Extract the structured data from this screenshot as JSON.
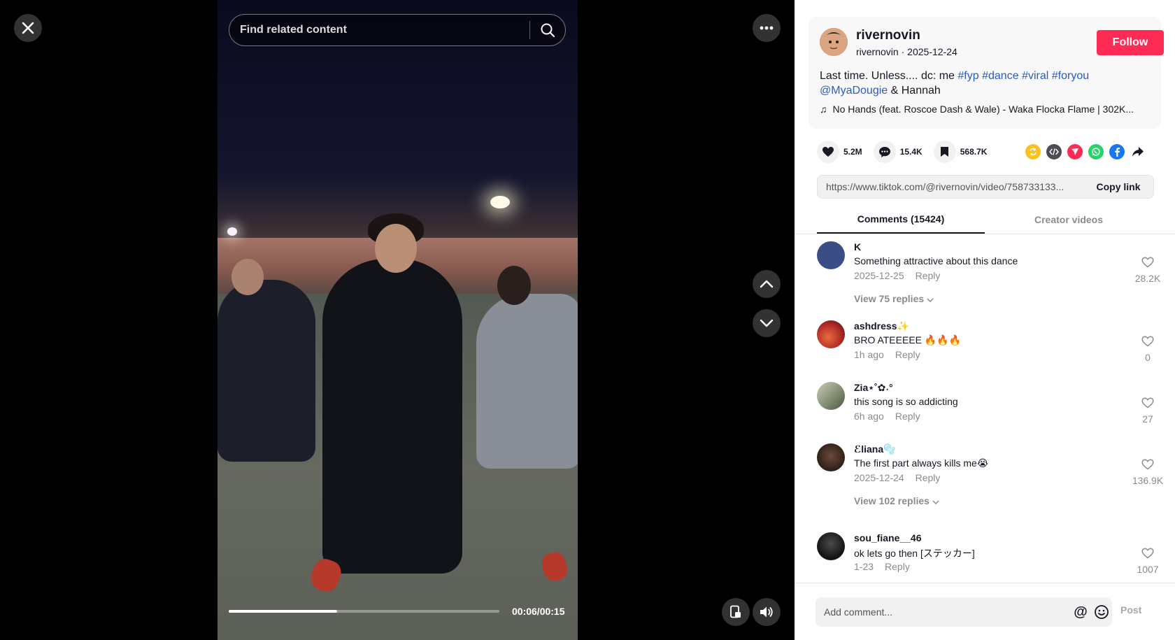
{
  "search": {
    "placeholder": "Find related content"
  },
  "video": {
    "time": "00:06/00:15",
    "progress": 0.4
  },
  "post": {
    "username": "rivernovin",
    "handle": "rivernovin",
    "date": "2025-12-24",
    "follow_label": "Follow",
    "desc_text": "Last time. Unless.... dc: me",
    "tags": [
      "#fyp",
      "#dance",
      "#viral",
      "#foryou"
    ],
    "mention": "@MyaDougie",
    "desc_tail": "& Hannah",
    "music": "No Hands (feat. Roscoe Dash & Wale) - Waka Flocka Flame | 302K..."
  },
  "stats": {
    "likes": "5.2M",
    "comments": "15.4K",
    "saves": "568.7K"
  },
  "link": {
    "url": "https://www.tiktok.com/@rivernovin/video/758733133...",
    "copy_label": "Copy link"
  },
  "tabs": {
    "comments": "Comments (15424)",
    "creator": "Creator videos"
  },
  "comments": [
    {
      "user": "K",
      "text": "Something attractive about this dance",
      "time": "2025-12-25",
      "reply": "Reply",
      "likes": "28.2K",
      "view": "View 75 replies",
      "avatar_color": "#3b4d86"
    },
    {
      "user": "ashdress✨",
      "text": "BRO ATEEEEE 🔥🔥🔥",
      "time": "1h ago",
      "reply": "Reply",
      "likes": "0",
      "view": "",
      "avatar_color": "#c0442c"
    },
    {
      "user": "Zia⋆˚✿˖°",
      "text": "this song is so addicting",
      "time": "6h ago",
      "reply": "Reply",
      "likes": "27",
      "view": "",
      "avatar_color": "#8f9a7c"
    },
    {
      "user": "ℰliana🫧",
      "text": "The first part always kills me😭",
      "time": "2025-12-24",
      "reply": "Reply",
      "likes": "136.9K",
      "view": "View 102 replies",
      "avatar_color": "#3a2a22"
    },
    {
      "user": "sou_fiane__46",
      "text": "ok lets go then [ステッカー]",
      "time": "1-23",
      "reply": "Reply",
      "likes": "1007",
      "view": "",
      "avatar_color": "#1d1d1d"
    }
  ],
  "add_comment": {
    "placeholder": "Add comment...",
    "post_label": "Post"
  },
  "colors": {
    "accent": "#fe2c55",
    "tag": "#2b5db9"
  }
}
